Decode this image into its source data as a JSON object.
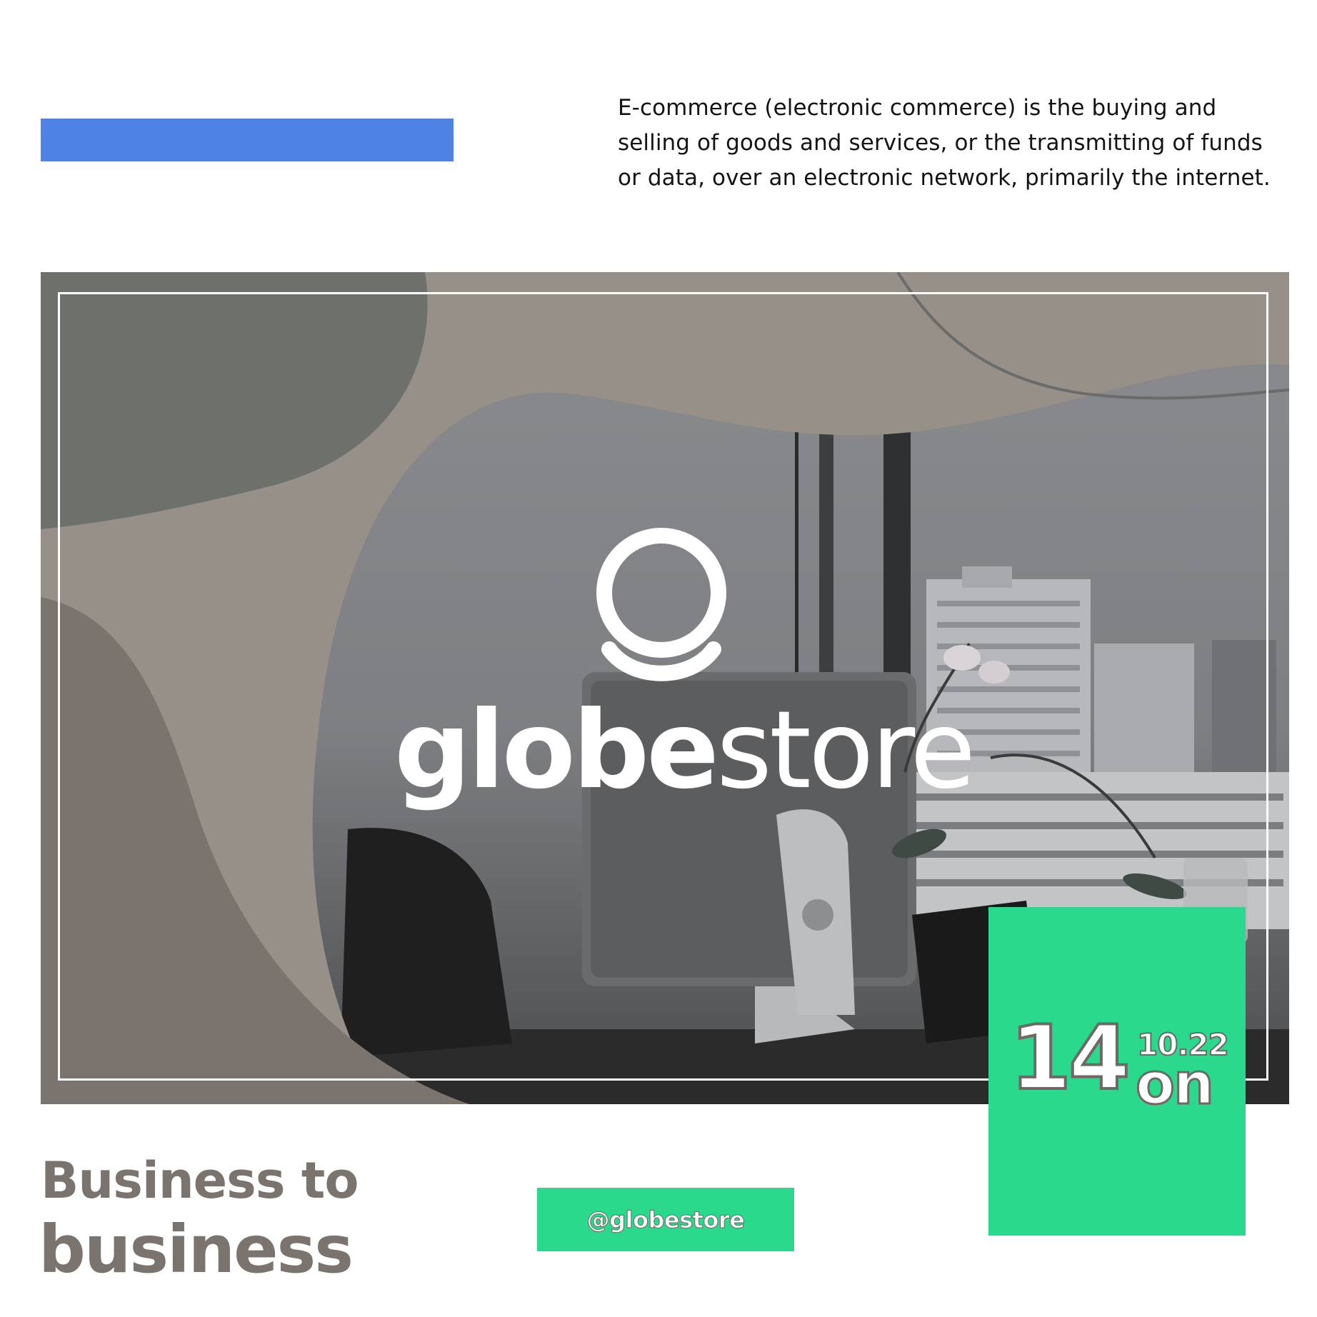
{
  "intro": {
    "text": "E-commerce (electronic commerce) is the buying and selling of goods and services, or the transmitting of funds or data, over an electronic network, primarily the internet."
  },
  "logo": {
    "icon": "globe-person-icon",
    "wordmark_bold": "globe",
    "wordmark_light": "store"
  },
  "date": {
    "day": "14",
    "month": "10.22",
    "suffix": "on"
  },
  "headline": {
    "line1": "Business to",
    "line2": "business"
  },
  "social": {
    "handle": "@globestore"
  },
  "colors": {
    "accent_blue": "#4f83e3",
    "accent_green": "#2ad98b",
    "text_gray": "#7b746e",
    "blob_light": "#969089",
    "blob_dark": "#6e706c",
    "blob_brown": "#7b746e"
  }
}
